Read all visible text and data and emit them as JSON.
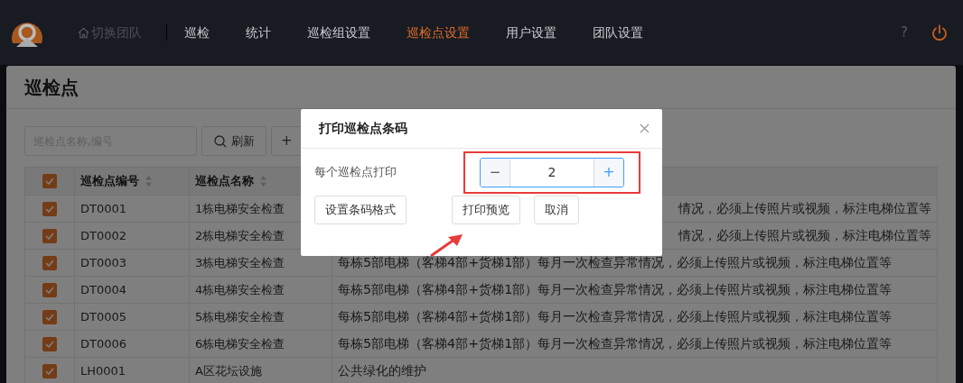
{
  "nav": {
    "team_switch": "切换团队",
    "items": [
      {
        "label": "巡检",
        "selected": false
      },
      {
        "label": "统计",
        "selected": false
      },
      {
        "label": "巡检组设置",
        "selected": false
      },
      {
        "label": "巡检点设置",
        "selected": true
      },
      {
        "label": "用户设置",
        "selected": false
      },
      {
        "label": "团队设置",
        "selected": false
      }
    ],
    "help": "?"
  },
  "page": {
    "title": "巡检点",
    "search": {
      "placeholder": "巡检点名称,编号"
    },
    "refresh_button": "刷新",
    "add_button": "+"
  },
  "table": {
    "header_checked": true,
    "columns": [
      "巡检点编号",
      "巡检点名称"
    ],
    "rows": [
      {
        "checked": true,
        "code": "DT0001",
        "name": "1栋电梯安全检查",
        "kind": "cut",
        "description": "情况，必须上传照片或视频，标注电梯位置等"
      },
      {
        "checked": true,
        "code": "DT0002",
        "name": "2栋电梯安全检查",
        "kind": "cut",
        "description": "情况，必须上传照片或视频，标注电梯位置等"
      },
      {
        "checked": true,
        "code": "DT0003",
        "name": "3栋电梯安全检查",
        "kind": "full",
        "description": "每栋5部电梯（客梯4部+货梯1部）每月一次检查异常情况，必须上传照片或视频，标注电梯位置等"
      },
      {
        "checked": true,
        "code": "DT0004",
        "name": "4栋电梯安全检查",
        "kind": "full",
        "description": "每栋5部电梯（客梯4部+货梯1部）每月一次检查异常情况，必须上传照片或视频，标注电梯位置等"
      },
      {
        "checked": true,
        "code": "DT0005",
        "name": "5栋电梯安全检查",
        "kind": "full",
        "description": "每栋5部电梯（客梯4部+货梯1部）每月一次检查异常情况，必须上传照片或视频，标注电梯位置等"
      },
      {
        "checked": true,
        "code": "DT0006",
        "name": "6栋电梯安全检查",
        "kind": "full",
        "description": "每栋5部电梯（客梯4部+货梯1部）每月一次检查异常情况，必须上传照片或视频，标注电梯位置等"
      },
      {
        "checked": true,
        "code": "LH0001",
        "name": "A区花坛设施",
        "kind": "full",
        "description": "公共绿化的维护"
      }
    ]
  },
  "dialog": {
    "title": "打印巡检点条码",
    "label": "每个巡检点打印",
    "stepper": {
      "minus": "−",
      "value": "2",
      "plus": "+"
    },
    "buttons": [
      "设置条码格式",
      "打印预览",
      "取消"
    ]
  }
}
